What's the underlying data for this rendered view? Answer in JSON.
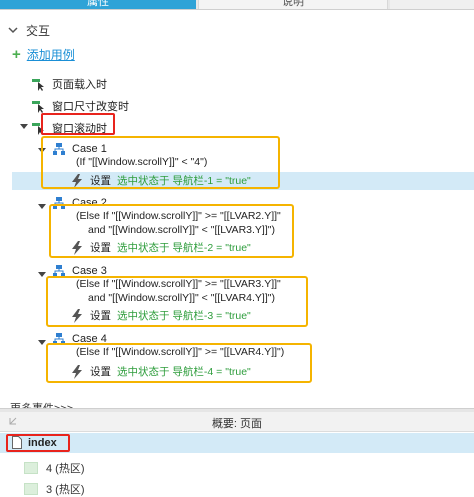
{
  "tabs": [
    {
      "label": "属性",
      "active": true
    },
    {
      "label": "说明",
      "active": false
    }
  ],
  "section": {
    "title": "交互"
  },
  "add_case": {
    "label": "添加用例"
  },
  "events": [
    {
      "label": "页面载入时"
    },
    {
      "label": "窗口尺寸改变时"
    },
    {
      "label": "窗口滚动时"
    }
  ],
  "cases": [
    {
      "name": "Case 1",
      "condition_lines": [
        "(If \"[[Window.scrollY]]\" < \"4\")"
      ],
      "action": {
        "verb": "设置",
        "detail": "选中状态于 导航栏-1 = \"true\""
      }
    },
    {
      "name": "Case 2",
      "condition_lines": [
        "(Else If \"[[Window.scrollY]]\" >= \"[[LVAR2.Y]]\"",
        "and \"[[Window.scrollY]]\" < \"[[LVAR3.Y]]\")"
      ],
      "action": {
        "verb": "设置",
        "detail": "选中状态于 导航栏-2 = \"true\""
      }
    },
    {
      "name": "Case 3",
      "condition_lines": [
        "(Else If \"[[Window.scrollY]]\" >= \"[[LVAR3.Y]]\"",
        "and \"[[Window.scrollY]]\" < \"[[LVAR4.Y]]\")"
      ],
      "action": {
        "verb": "设置",
        "detail": "选中状态于 导航栏-3 = \"true\""
      }
    },
    {
      "name": "Case 4",
      "condition_lines": [
        "(Else If \"[[Window.scrollY]]\" >= \"[[LVAR4.Y]]\")"
      ],
      "action": {
        "verb": "设置",
        "detail": "选中状态于 导航栏-4 = \"true\""
      }
    }
  ],
  "more_events": "更多事件>>>",
  "outline": {
    "title": "概要: 页面",
    "root": "index",
    "items": [
      {
        "label": "4 (热区)"
      },
      {
        "label": "3 (热区)"
      }
    ]
  },
  "colors": {
    "accent_blue": "#2fa3d7",
    "selection": "#d3eaf7",
    "action_green": "#2e9d3c",
    "highlight_red": "#e8241d",
    "highlight_orange": "#f5b400"
  }
}
